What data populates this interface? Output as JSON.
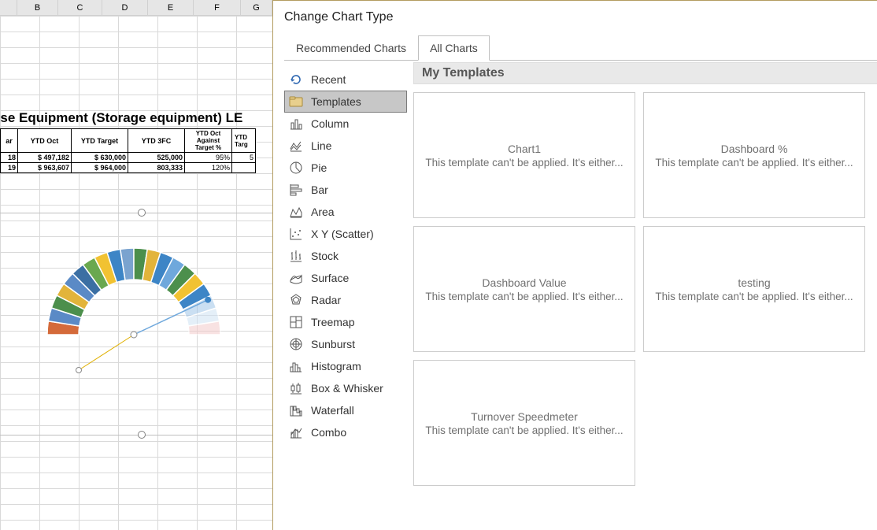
{
  "sheet": {
    "title_fragment": "use Equipment (Storage equipment) LE",
    "columns": [
      "",
      "B",
      "C",
      "D",
      "E",
      "F",
      "G"
    ],
    "headers": [
      "ar",
      "YTD Oct",
      "YTD Target",
      "YTD 3FC",
      "YTD Oct Against Target %",
      "YTD Targ"
    ],
    "rows": [
      [
        "18",
        "$  497,182",
        "$  630,000",
        "525,000",
        "95%",
        "5"
      ],
      [
        "19",
        "$  963,607",
        "$  964,000",
        "803,333",
        "120%",
        ""
      ]
    ]
  },
  "dialog": {
    "title": "Change Chart Type",
    "tabs": [
      {
        "label": "Recommended Charts",
        "active": false
      },
      {
        "label": "All Charts",
        "active": true
      }
    ],
    "types": [
      {
        "key": "recent",
        "label": "Recent"
      },
      {
        "key": "templates",
        "label": "Templates",
        "selected": true
      },
      {
        "key": "column",
        "label": "Column"
      },
      {
        "key": "line",
        "label": "Line"
      },
      {
        "key": "pie",
        "label": "Pie"
      },
      {
        "key": "bar",
        "label": "Bar"
      },
      {
        "key": "area",
        "label": "Area"
      },
      {
        "key": "scatter",
        "label": "X Y (Scatter)"
      },
      {
        "key": "stock",
        "label": "Stock"
      },
      {
        "key": "surface",
        "label": "Surface"
      },
      {
        "key": "radar",
        "label": "Radar"
      },
      {
        "key": "treemap",
        "label": "Treemap"
      },
      {
        "key": "sunburst",
        "label": "Sunburst"
      },
      {
        "key": "histogram",
        "label": "Histogram"
      },
      {
        "key": "boxwhisk",
        "label": "Box & Whisker"
      },
      {
        "key": "waterfall",
        "label": "Waterfall"
      },
      {
        "key": "combo",
        "label": "Combo"
      }
    ],
    "pane_heading": "My Templates",
    "templates_msg": "This template can't be applied. It's either...",
    "templates": [
      {
        "name": "Chart1"
      },
      {
        "name": "Dashboard %"
      },
      {
        "name": "Dashboard Value"
      },
      {
        "name": "testing"
      },
      {
        "name": "Turnover Speedmeter"
      }
    ]
  },
  "chart_data": {
    "type": "pie",
    "note": "semi-donut speedometer gauge; needle slices highlighted",
    "slices_deg": [
      9,
      9,
      9,
      9,
      9,
      9,
      9,
      9,
      9,
      9,
      9,
      9,
      9,
      9,
      9,
      9,
      9,
      9,
      9,
      9
    ],
    "colors": [
      "#d46a3a",
      "#5a8ac6",
      "#4c8f4c",
      "#e2b43b",
      "#5a8ac6",
      "#3b6fa3",
      "#6aa84f",
      "#f1c232",
      "#3d85c6",
      "#7aa3cf",
      "#4c8f4c",
      "#e2b43b",
      "#3d85c6",
      "#6fa8dc",
      "#4c8f4c",
      "#f1c232",
      "#3d85c6",
      "#9fc5e8",
      "#cfe2f3",
      "#f4cccc"
    ]
  }
}
